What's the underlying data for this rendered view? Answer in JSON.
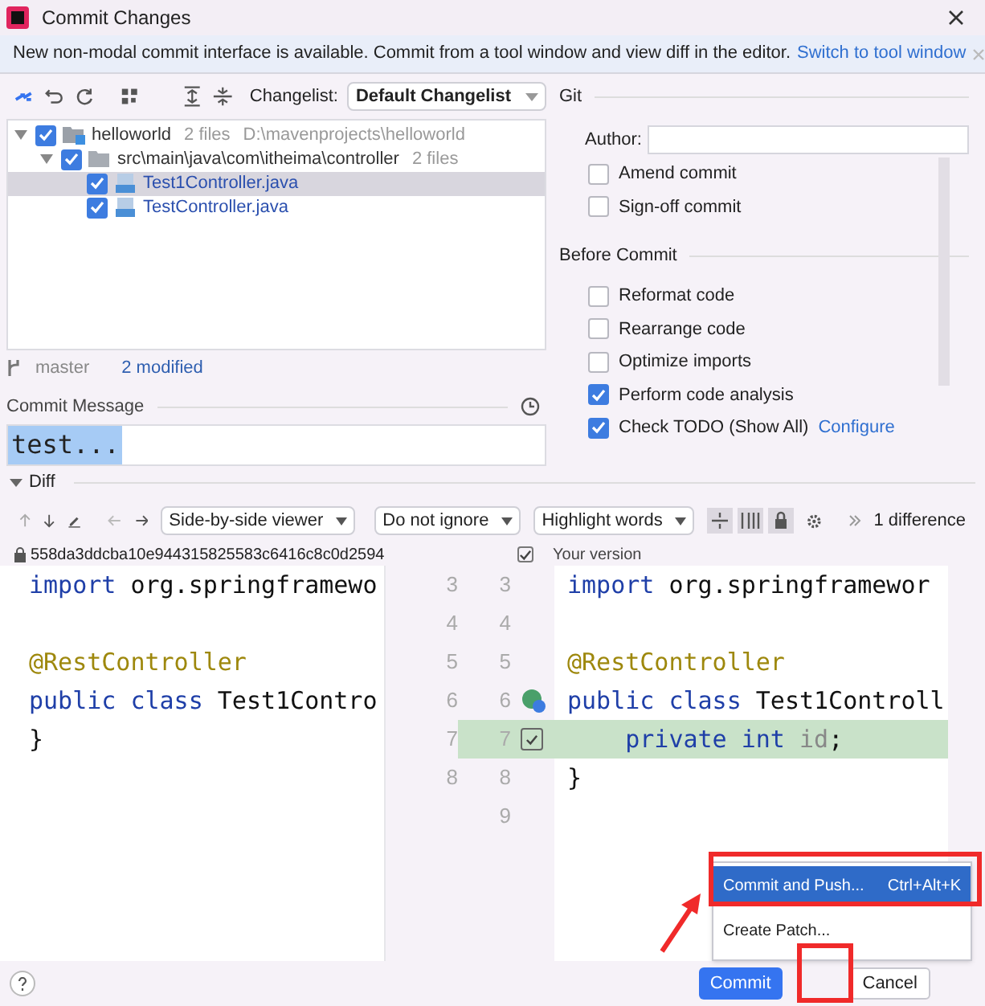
{
  "window": {
    "title": "Commit Changes"
  },
  "banner": {
    "text": "New non-modal commit interface is available. Commit from a tool window and view diff in the editor.",
    "link": "Switch to tool window"
  },
  "changelist": {
    "label": "Changelist:",
    "value": "Default Changelist"
  },
  "tree": [
    {
      "name": "helloworld",
      "count": "2 files",
      "path": "D:\\mavenprojects\\helloworld",
      "kind": "module",
      "checked": true,
      "expanded": true,
      "selected": false,
      "children": [
        {
          "name": "src\\main\\java\\com\\itheima\\controller",
          "count": "2 files",
          "kind": "folder",
          "checked": true,
          "expanded": true,
          "selected": false,
          "children": [
            {
              "name": "Test1Controller.java",
              "kind": "file",
              "checked": true,
              "selected": true
            },
            {
              "name": "TestController.java",
              "kind": "file",
              "checked": true,
              "selected": false
            }
          ]
        }
      ]
    }
  ],
  "status": {
    "branch": "master",
    "modified": "2 modified"
  },
  "commit_message": {
    "label": "Commit Message",
    "value": "test..."
  },
  "git": {
    "title": "Git",
    "author_label": "Author:",
    "options": [
      {
        "label": "Amend commit",
        "checked": false
      },
      {
        "label": "Sign-off commit",
        "checked": false
      }
    ]
  },
  "before_commit": {
    "title": "Before Commit",
    "options": [
      {
        "label": "Reformat code",
        "checked": false
      },
      {
        "label": "Rearrange code",
        "checked": false
      },
      {
        "label": "Optimize imports",
        "checked": false
      },
      {
        "label": "Perform code analysis",
        "checked": true
      },
      {
        "label": "Check TODO (Show All)",
        "checked": true,
        "link": "Configure"
      }
    ]
  },
  "diff": {
    "title": "Diff",
    "expanded": true,
    "viewer": "Side-by-side viewer",
    "ignore": "Do not ignore",
    "highlight": "Highlight words",
    "differences": "1 difference",
    "left_title": "558da3ddcba10e944315825583c6416c8c0d2594",
    "right_title": "Your version",
    "include_checked": true,
    "rows": [
      {
        "left_number": "3",
        "right_number": "3",
        "changed": false,
        "left": [
          {
            "text": "import",
            "kind": "keyword"
          },
          {
            "text": " org.springframewo",
            "kind": "plain"
          }
        ],
        "right": [
          {
            "text": "import",
            "kind": "keyword"
          },
          {
            "text": " org.springframewor",
            "kind": "plain"
          }
        ]
      },
      {
        "left_number": "4",
        "right_number": "4",
        "changed": false,
        "left": [],
        "right": []
      },
      {
        "left_number": "5",
        "right_number": "5",
        "changed": false,
        "left": [
          {
            "text": "@RestController",
            "kind": "annotation"
          }
        ],
        "right": [
          {
            "text": "@RestController",
            "kind": "annotation"
          }
        ]
      },
      {
        "left_number": "6",
        "right_number": "6",
        "changed": false,
        "class_marker": true,
        "left": [
          {
            "text": "public class",
            "kind": "keyword"
          },
          {
            "text": " Test1Contro",
            "kind": "plain"
          }
        ],
        "right": [
          {
            "text": "public class",
            "kind": "keyword"
          },
          {
            "text": " Test1Controll",
            "kind": "plain"
          }
        ]
      },
      {
        "left_number": "7",
        "right_number": "7",
        "changed": true,
        "checked": true,
        "left": [
          {
            "text": "}",
            "kind": "plain"
          }
        ],
        "right": [
          {
            "text": "    private int",
            "kind": "keyword"
          },
          {
            "text": " id",
            "kind": "field"
          },
          {
            "text": ";",
            "kind": "plain"
          }
        ]
      },
      {
        "left_number": "8",
        "right_number": "8",
        "changed": false,
        "left": [],
        "right": [
          {
            "text": "}",
            "kind": "plain"
          }
        ]
      },
      {
        "right_number": "9",
        "changed": false,
        "left": [],
        "right": []
      }
    ]
  },
  "menu": [
    {
      "label": "Commit and Push...",
      "shortcut": "Ctrl+Alt+K",
      "selected": true
    },
    {
      "label": "Create Patch...",
      "selected": false
    }
  ],
  "buttons": [
    {
      "label": "Commit",
      "kind": "primary"
    },
    {
      "label": "Cancel",
      "kind": "secondary"
    }
  ]
}
